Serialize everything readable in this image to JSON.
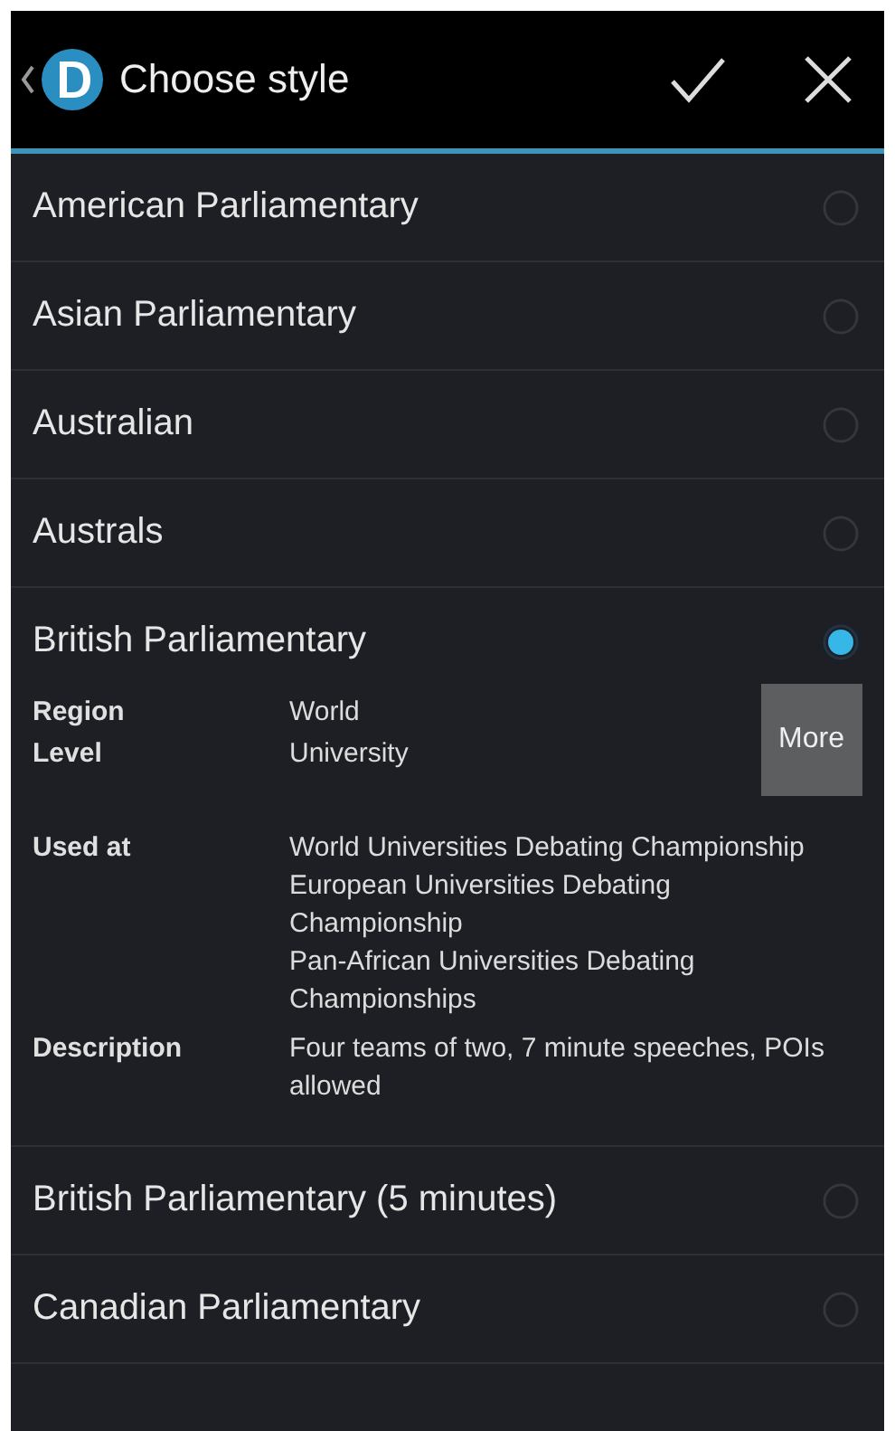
{
  "action_bar": {
    "title": "Choose style"
  },
  "styles": [
    {
      "name": "American Parliamentary",
      "selected": false
    },
    {
      "name": "Asian Parliamentary",
      "selected": false
    },
    {
      "name": "Australian",
      "selected": false
    },
    {
      "name": "Australs",
      "selected": false
    },
    {
      "name": "British Parliamentary",
      "selected": true,
      "details": {
        "summary": [
          {
            "label": "Region",
            "value": "World"
          },
          {
            "label": "Level",
            "value": "University"
          }
        ],
        "more_button": "More",
        "rows": [
          {
            "label": "Used at",
            "lines": [
              "World Universities Debating Championship",
              "European Universities Debating Championship",
              "Pan-African Universities Debating Championships"
            ]
          },
          {
            "label": "Description",
            "lines": [
              "Four teams of two, 7 minute speeches, POIs allowed"
            ]
          }
        ]
      }
    },
    {
      "name": "British Parliamentary (5 minutes)",
      "selected": false
    },
    {
      "name": "Canadian Parliamentary",
      "selected": false
    }
  ]
}
